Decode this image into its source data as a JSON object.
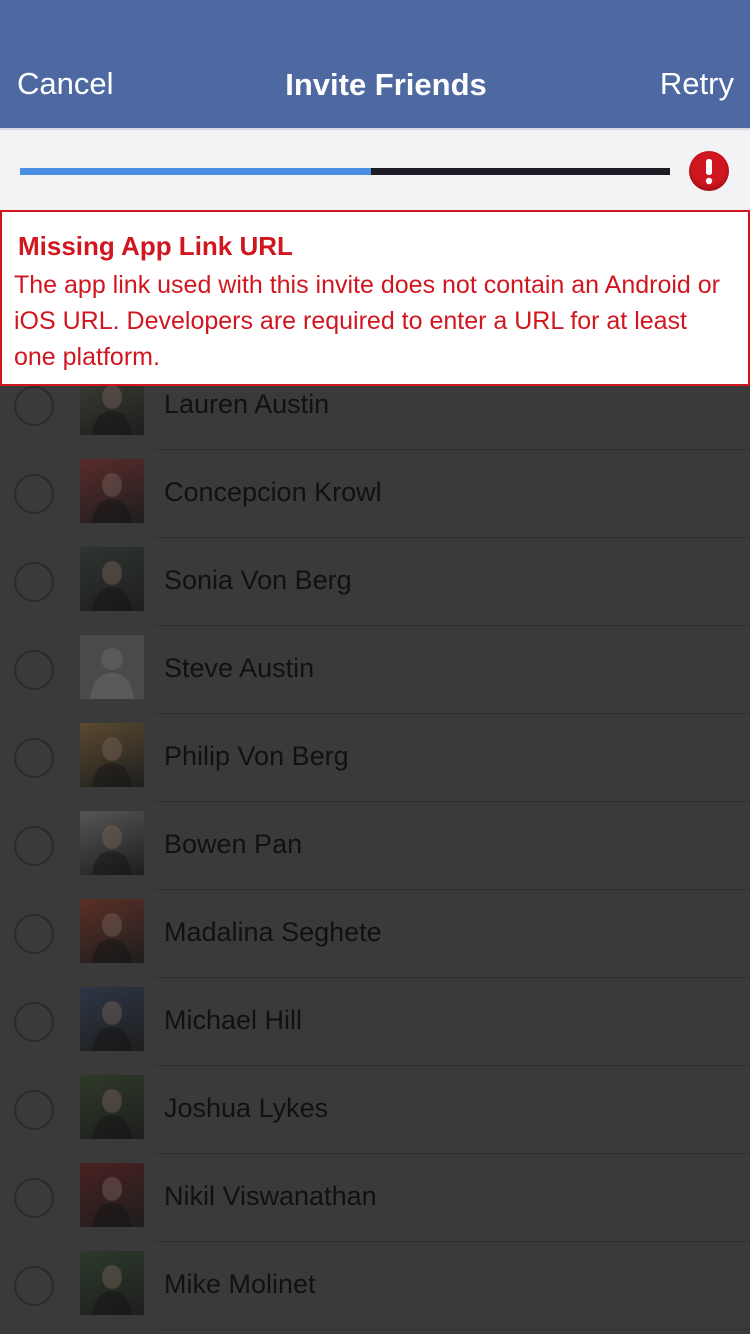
{
  "nav": {
    "cancel_label": "Cancel",
    "title": "Invite Friends",
    "retry_label": "Retry",
    "bar_color": "#4e69a2"
  },
  "progress": {
    "fraction": 0.54,
    "fill_color": "#4a90e2",
    "status_icon": "error-exclamation-icon"
  },
  "error": {
    "title": "Missing App Link URL",
    "message": "The app link used with this invite does not contain an Android or iOS URL. Developers are required to enter a URL for at least one platform.",
    "color": "#d0161f"
  },
  "friends": [
    {
      "name": "Lauren Austin",
      "avatar": "photo",
      "tint": "#3b3f35"
    },
    {
      "name": "Concepcion Krowl",
      "avatar": "photo",
      "tint": "#5a2b2b"
    },
    {
      "name": "Sonia Von Berg",
      "avatar": "photo",
      "tint": "#2f3530"
    },
    {
      "name": "Steve Austin",
      "avatar": "default-silhouette",
      "tint": "#4a4a4a"
    },
    {
      "name": "Philip Von Berg",
      "avatar": "photo",
      "tint": "#5a4a30"
    },
    {
      "name": "Bowen Pan",
      "avatar": "photo",
      "tint": "#555555"
    },
    {
      "name": "Madalina Seghete",
      "avatar": "photo",
      "tint": "#5a2f26"
    },
    {
      "name": "Michael Hill",
      "avatar": "photo",
      "tint": "#2e3646"
    },
    {
      "name": "Joshua Lykes",
      "avatar": "photo",
      "tint": "#2f3a28"
    },
    {
      "name": "Nikil Viswanathan",
      "avatar": "photo",
      "tint": "#4a2020"
    },
    {
      "name": "Mike Molinet",
      "avatar": "photo",
      "tint": "#2c3a2c"
    }
  ]
}
